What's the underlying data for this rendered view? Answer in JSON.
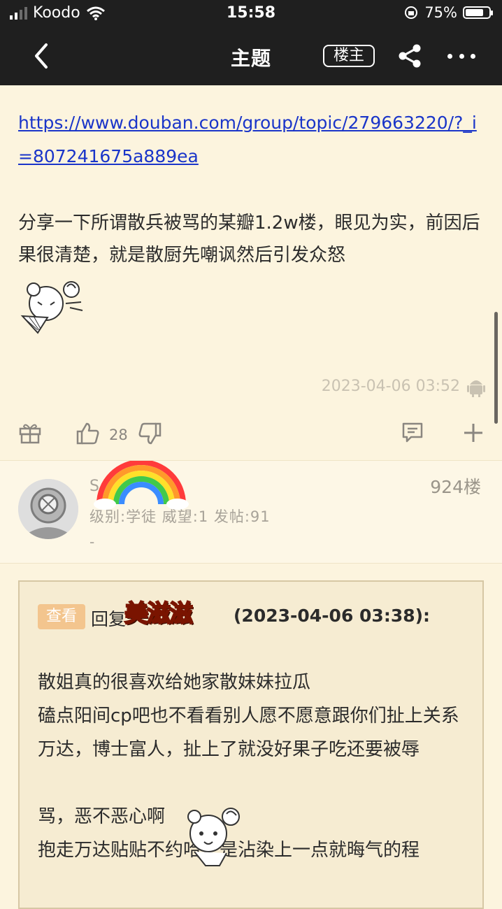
{
  "status_bar": {
    "carrier": "Koodo",
    "time": "15:58",
    "battery": "75%"
  },
  "nav": {
    "title": "主题",
    "owner_label": "楼主"
  },
  "post": {
    "link": "https://www.douban.com/group/topic/279663220/?_i=807241675a889ea",
    "paragraph": "分享一下所谓散兵被骂的某瓣1.2w楼，眼见为实，前因后果很清楚，就是散厨先嘲讽然后引发众怒",
    "timestamp": "2023-04-06 03:52",
    "like_count": "28"
  },
  "reply": {
    "username": "S",
    "meta": "级别:学徒   威望:1   发帖:91",
    "dash": "-",
    "floor": "924楼",
    "quote": {
      "view_label": "查看",
      "reply_prefix": "回复",
      "quoted_user": "美滋滋",
      "date": "(2023-04-06 03:38):",
      "lines": [
        "散姐真的很喜欢给她家散妹妹拉瓜",
        "磕点阳间cp吧也不看看别人愿不愿意跟你们扯上关系",
        "万达，博士富人，扯上了就没好果子吃还要被辱",
        "骂，恶不恶心啊",
        "抱走万达贴贴不约哈，是沾染上一点就晦气的程"
      ]
    }
  },
  "colors": {
    "background": "#fcf4de",
    "topbar": "#1f1f1f",
    "link": "#1a35c9",
    "view_button": "#f3c58e"
  }
}
